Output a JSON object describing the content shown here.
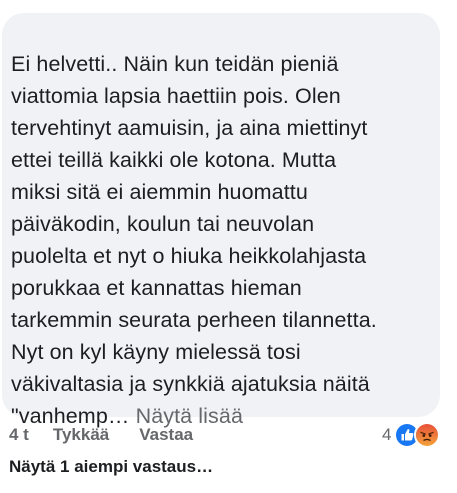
{
  "comment": {
    "lines": [
      "Ei helvetti.. Näin kun teidän pieniä",
      "viattomia lapsia haettiin pois. Olen",
      "tervehtinyt aamuisin, ja aina miettinyt",
      "ettei teillä kaikki ole kotona. Mutta",
      "miksi sitä ei aiemmin huomattu",
      "päiväkodin, koulun tai neuvolan",
      "puolelta et nyt o hiuka heikkolahjasta",
      "porukkaa et kannattas hieman",
      "tarkemmin seurata perheen tilannetta.",
      "Nyt on kyl käyny mielessä tosi",
      "väkivaltasia ja synkkiä ajatuksia näitä"
    ],
    "last_line_text": "\"vanhemp…",
    "see_more_label": "Näytä lisää"
  },
  "actions": {
    "timestamp": "4 t",
    "like_label": "Tykkää",
    "reply_label": "Vastaa"
  },
  "reactions": {
    "count": "4",
    "icons": [
      "like-reaction-icon",
      "angry-reaction-icon"
    ],
    "colors": {
      "like": "#1877f2",
      "angry": "#f0702c"
    }
  },
  "replies": {
    "label": "Näytä 1 aiempi vastaus…"
  },
  "colors": {
    "bubble_bg": "#f0f2f5",
    "text": "#1c1e21",
    "secondary": "#65676b"
  }
}
